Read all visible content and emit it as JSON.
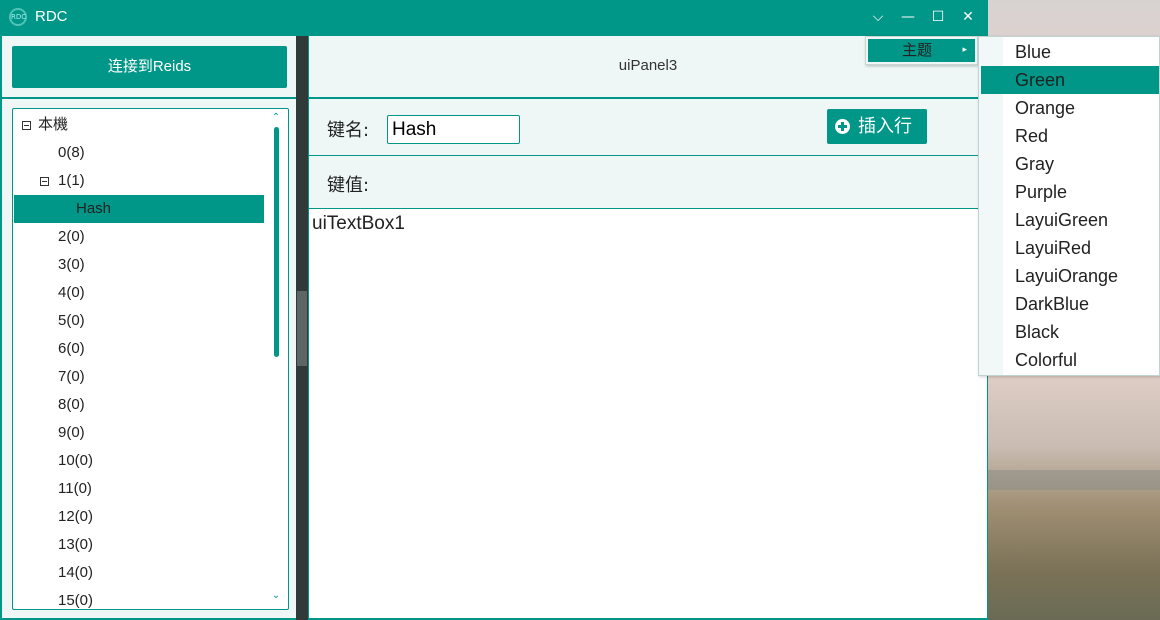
{
  "window": {
    "title": "RDC",
    "icon": "app-logo-icon",
    "accent": "#009688"
  },
  "titlebar_buttons": [
    "chevron-down-icon",
    "minimize-icon",
    "maximize-icon",
    "close-icon"
  ],
  "titlebar_glyphs": {
    "menu": "⌵",
    "min": "—",
    "max": "☐",
    "close": "✕"
  },
  "sidebar": {
    "connect_label": "连接到Reids",
    "tree": [
      {
        "label": "本機",
        "level": 0,
        "expander": true
      },
      {
        "label": "0(8)",
        "level": 1
      },
      {
        "label": "1(1)",
        "level": 1,
        "expander": true
      },
      {
        "label": "Hash",
        "level": 2,
        "selected": true
      },
      {
        "label": "2(0)",
        "level": 1
      },
      {
        "label": "3(0)",
        "level": 1
      },
      {
        "label": "4(0)",
        "level": 1
      },
      {
        "label": "5(0)",
        "level": 1
      },
      {
        "label": "6(0)",
        "level": 1
      },
      {
        "label": "7(0)",
        "level": 1
      },
      {
        "label": "8(0)",
        "level": 1
      },
      {
        "label": "9(0)",
        "level": 1
      },
      {
        "label": "10(0)",
        "level": 1
      },
      {
        "label": "11(0)",
        "level": 1
      },
      {
        "label": "12(0)",
        "level": 1
      },
      {
        "label": "13(0)",
        "level": 1
      },
      {
        "label": "14(0)",
        "level": 1
      },
      {
        "label": "15(0)",
        "level": 1
      }
    ],
    "scroll_up": "⌃",
    "scroll_down": "⌄"
  },
  "main": {
    "panel_title": "uiPanel3",
    "key_name_label": "键名:",
    "key_name_value": "Hash",
    "insert_label": "插入行",
    "key_value_label": "键值:",
    "textbox_label": "uiTextBox1"
  },
  "context_menu": {
    "label": "主题",
    "arrow": "▸"
  },
  "theme_menu": {
    "items": [
      "Blue",
      "Green",
      "Orange",
      "Red",
      "Gray",
      "Purple",
      "LayuiGreen",
      "LayuiRed",
      "LayuiOrange",
      "DarkBlue",
      "Black",
      "Colorful"
    ],
    "active": "Green"
  }
}
